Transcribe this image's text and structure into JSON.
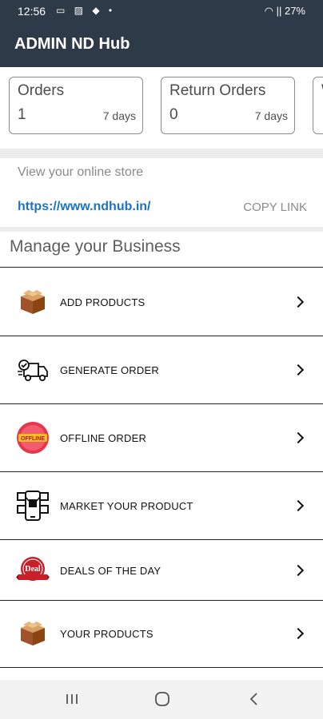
{
  "status_bar": {
    "time": "12:56",
    "battery": "27%",
    "left_icons": "▭ ▨ ◆ •",
    "right_icons": "◠ ||"
  },
  "app_bar": {
    "title": "ADMIN ND Hub"
  },
  "stats": [
    {
      "label": "Orders",
      "count": "1",
      "period": "7 days"
    },
    {
      "label": "Return Orders",
      "count": "0",
      "period": "7 days"
    },
    {
      "label": "W",
      "count": "",
      "period": ""
    }
  ],
  "store": {
    "label": "View your online store",
    "url": "https://www.ndhub.in/",
    "copy_label": "COPY LINK"
  },
  "section_title": "Manage your Business",
  "menu": [
    {
      "label": "ADD PRODUCTS",
      "icon": "product-box-icon"
    },
    {
      "label": "GENERATE ORDER",
      "icon": "delivery-truck-icon"
    },
    {
      "label": "OFFLINE ORDER",
      "icon": "offline-badge-icon",
      "badge_text": "OFFLINE"
    },
    {
      "label": "MARKET YOUR PRODUCT",
      "icon": "social-share-phone-icon"
    },
    {
      "label": "DEALS OF THE DAY",
      "icon": "deal-badge-icon",
      "badge_text": "Deal"
    },
    {
      "label": "YOUR PRODUCTS",
      "icon": "product-box-icon"
    }
  ],
  "nav": {
    "recents": "recents-icon",
    "home": "home-icon",
    "back": "back-icon"
  },
  "colors": {
    "app_bar": "#2f3a49",
    "link": "#1a73c9",
    "offline_badge": "#e8354a",
    "deal_badge": "#c8202a"
  }
}
